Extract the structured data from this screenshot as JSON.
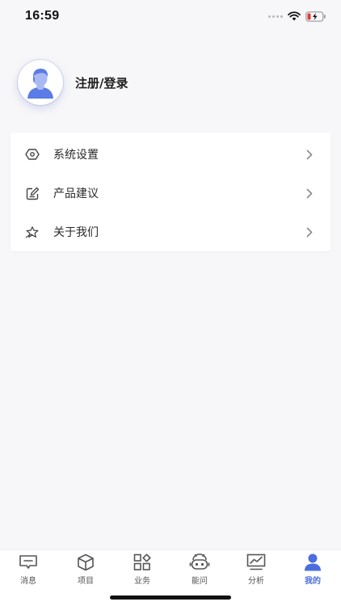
{
  "status_bar": {
    "time": "16:59",
    "icons": [
      "signal-dots-icon",
      "wifi-icon",
      "battery-charging-icon"
    ]
  },
  "profile": {
    "label": "注册/登录",
    "avatar_icon": "default-user-avatar-icon"
  },
  "menu": {
    "items": [
      {
        "label": "系统设置",
        "icon": "settings-hexagon-icon"
      },
      {
        "label": "产品建议",
        "icon": "edit-feedback-icon"
      },
      {
        "label": "关于我们",
        "icon": "about-star-icon"
      }
    ],
    "chevron_icon": "chevron-right-icon"
  },
  "tab_bar": {
    "tabs": [
      {
        "label": "消息",
        "icon": "message-icon",
        "active": false
      },
      {
        "label": "项目",
        "icon": "project-box-icon",
        "active": false
      },
      {
        "label": "业务",
        "icon": "business-grid-icon",
        "active": false
      },
      {
        "label": "能问",
        "icon": "robot-ask-icon",
        "active": false
      },
      {
        "label": "分析",
        "icon": "analysis-chart-icon",
        "active": false
      },
      {
        "label": "我的",
        "icon": "user-profile-icon",
        "active": true
      }
    ]
  },
  "colors": {
    "accent": "#4a6ee0",
    "background": "#f7f7f9",
    "card": "#ffffff",
    "icon_gray": "#555555"
  }
}
